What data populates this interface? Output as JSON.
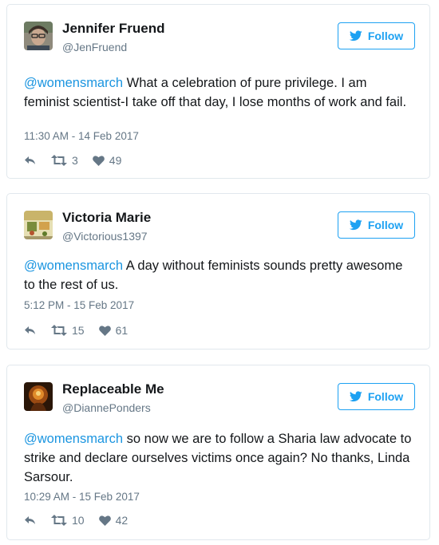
{
  "tweets": [
    {
      "name": "Jennifer Fruend",
      "handle": "@JenFruend",
      "follow_label": "Follow",
      "mention": "@womensmarch",
      "text": " What a celebration of pure privilege. I am feminist scientist-I take off that day, I lose months of work and fail.",
      "timestamp": "11:30 AM - 14 Feb 2017",
      "retweets": "3",
      "likes": "49"
    },
    {
      "name": "Victoria Marie",
      "handle": "@Victorious1397",
      "follow_label": "Follow",
      "mention": "@womensmarch",
      "text": " A day without feminists sounds pretty awesome to the rest of us.",
      "timestamp": "5:12 PM - 15 Feb 2017",
      "retweets": "15",
      "likes": "61"
    },
    {
      "name": "Replaceable Me",
      "handle": "@DiannePonders",
      "follow_label": "Follow",
      "mention": "@womensmarch",
      "text": " so now we are to follow a Sharia law advocate to strike and declare ourselves victims once again? No thanks, Linda Sarsour.",
      "timestamp": "10:29 AM - 15 Feb 2017",
      "retweets": "10",
      "likes": "42"
    }
  ],
  "icons": {
    "follow": "twitter-bird-icon",
    "reply": "reply-icon",
    "retweet": "retweet-icon",
    "like": "heart-icon"
  },
  "colors": {
    "accent": "#1da1f2",
    "mention": "#1b95e0",
    "muted": "#657786",
    "border": "#e1e8ed"
  }
}
